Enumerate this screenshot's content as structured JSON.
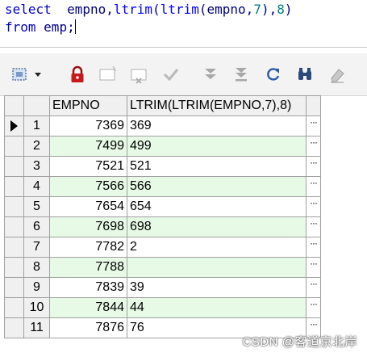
{
  "editor": {
    "line1": {
      "kw_select": "select",
      "space1": "  ",
      "col_empno": "empno",
      "comma1": ",",
      "fn_ltrim1": "ltrim",
      "paren1": "(",
      "fn_ltrim2": "ltrim",
      "paren2": "(",
      "arg_empno": "empno",
      "comma2": ",",
      "num7": "7",
      "close1": "),",
      "num8": "8",
      "close2": ")"
    },
    "line2": {
      "kw_from": "from",
      "space": " ",
      "tbl": "emp",
      "semi": ";"
    }
  },
  "toolbar": {
    "icons": [
      "grid-select-icon",
      "dropdown-arrow-icon",
      "lock-icon",
      "new-record-icon",
      "delete-record-icon",
      "post-check-icon",
      "fetch-next-icon",
      "fetch-last-icon",
      "refresh-icon",
      "find-icon",
      "clear-icon"
    ]
  },
  "grid": {
    "columns": [
      "EMPNO",
      "LTRIM(LTRIM(EMPNO,7),8)"
    ],
    "ellipsis": "···",
    "rows": [
      {
        "n": "1",
        "empno": "7369",
        "lt": "369"
      },
      {
        "n": "2",
        "empno": "7499",
        "lt": "499"
      },
      {
        "n": "3",
        "empno": "7521",
        "lt": "521"
      },
      {
        "n": "4",
        "empno": "7566",
        "lt": "566"
      },
      {
        "n": "5",
        "empno": "7654",
        "lt": "654"
      },
      {
        "n": "6",
        "empno": "7698",
        "lt": "698"
      },
      {
        "n": "7",
        "empno": "7782",
        "lt": "2"
      },
      {
        "n": "8",
        "empno": "7788",
        "lt": ""
      },
      {
        "n": "9",
        "empno": "7839",
        "lt": "39"
      },
      {
        "n": "10",
        "empno": "7844",
        "lt": "44"
      },
      {
        "n": "11",
        "empno": "7876",
        "lt": "76"
      }
    ]
  },
  "watermark": "CSDN @客道京北岸"
}
